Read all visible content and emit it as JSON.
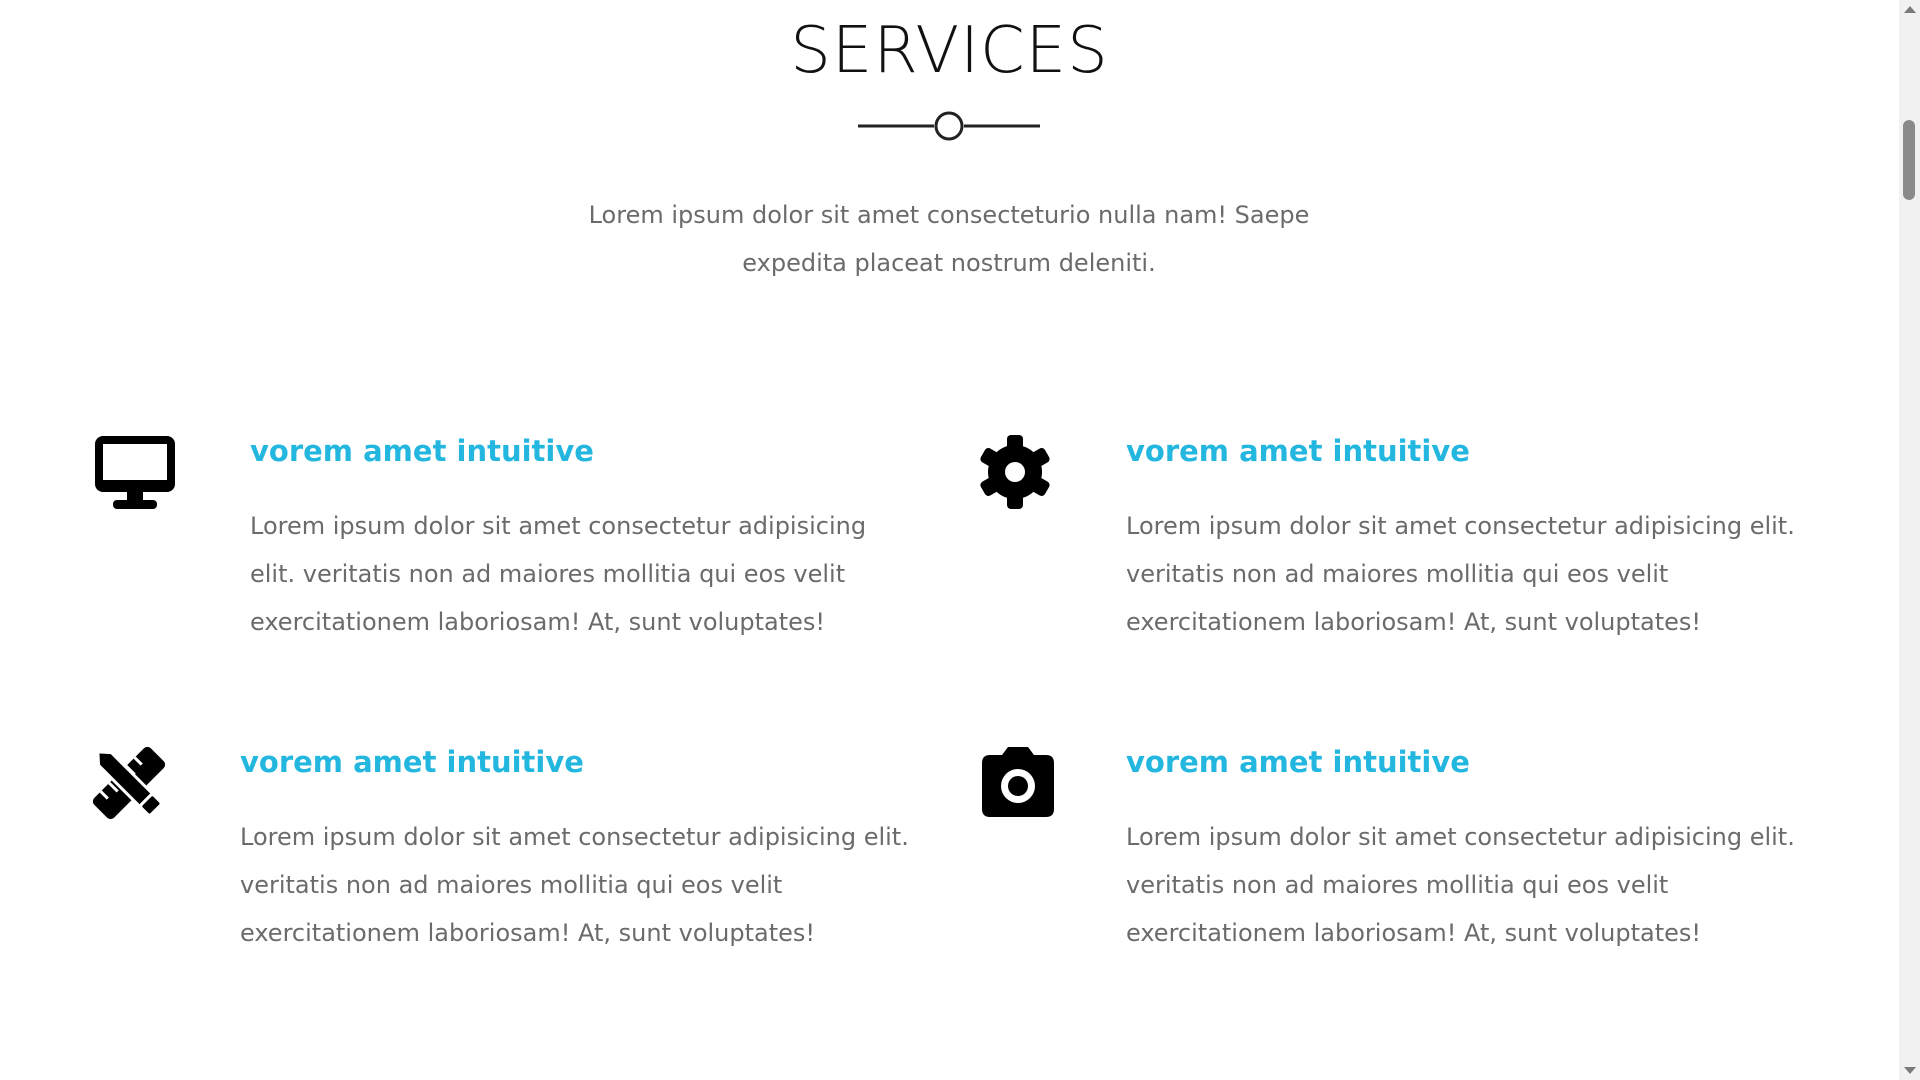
{
  "section": {
    "title": "SERVICES",
    "intro": "Lorem ipsum dolor sit amet consecteturio nulla nam! Saepe expedita placeat nostrum deleniti."
  },
  "colors": {
    "accent": "#23b7e0",
    "text": "#6b6b6b",
    "heading": "#111111"
  },
  "services": [
    {
      "icon": "desktop-icon",
      "title": "vorem amet intuitive",
      "description": "Lorem ipsum dolor sit amet consectetur adipisicing elit. veritatis non ad maiores mollitia qui eos velit exercitationem laboriosam! At, sunt voluptates!"
    },
    {
      "icon": "gear-icon",
      "title": "vorem amet intuitive",
      "description": "Lorem ipsum dolor sit amet consectetur adipisicing elit. veritatis non ad maiores mollitia qui eos velit exercitationem laboriosam! At, sunt voluptates!"
    },
    {
      "icon": "pencil-ruler-icon",
      "title": "vorem amet intuitive",
      "description": "Lorem ipsum dolor sit amet consectetur adipisicing elit. veritatis non ad maiores mollitia qui eos velit exercitationem laboriosam! At, sunt voluptates!"
    },
    {
      "icon": "camera-icon",
      "title": "vorem amet intuitive",
      "description": "Lorem ipsum dolor sit amet consectetur adipisicing elit. veritatis non ad maiores mollitia qui eos velit exercitationem laboriosam! At, sunt voluptates!"
    }
  ]
}
